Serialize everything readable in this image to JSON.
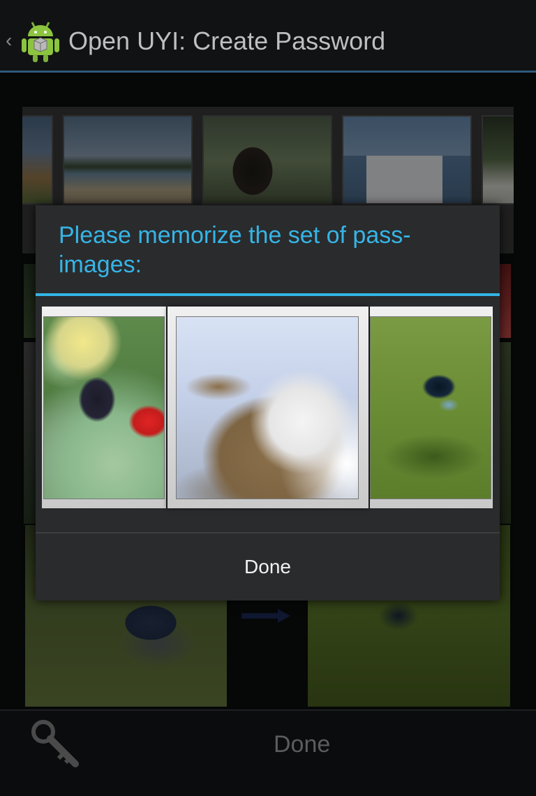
{
  "app": {
    "title": "Open UYI: Create Password",
    "icon": "android-robot-icon"
  },
  "dialog": {
    "title": "Please memorize the set of pass-images:",
    "done_label": "Done",
    "pass_images": [
      {
        "icon": "blurred-flowers-image"
      },
      {
        "icon": "blurred-cat-image",
        "selected": true
      },
      {
        "icon": "blurred-bird-on-grass-image"
      }
    ]
  },
  "background": {
    "strip_images": [
      "coast-image",
      "island-beach-image",
      "wallaby-image",
      "ferry-boat-image",
      "flower-image"
    ],
    "tiles": [
      "bird-image",
      "blurred-bird-image"
    ],
    "done_label": "Done",
    "key_icon": "key-icon"
  },
  "colors": {
    "accent": "#33b5e5",
    "action_bar": "#111214",
    "dialog_bg": "#2a2b2d"
  }
}
